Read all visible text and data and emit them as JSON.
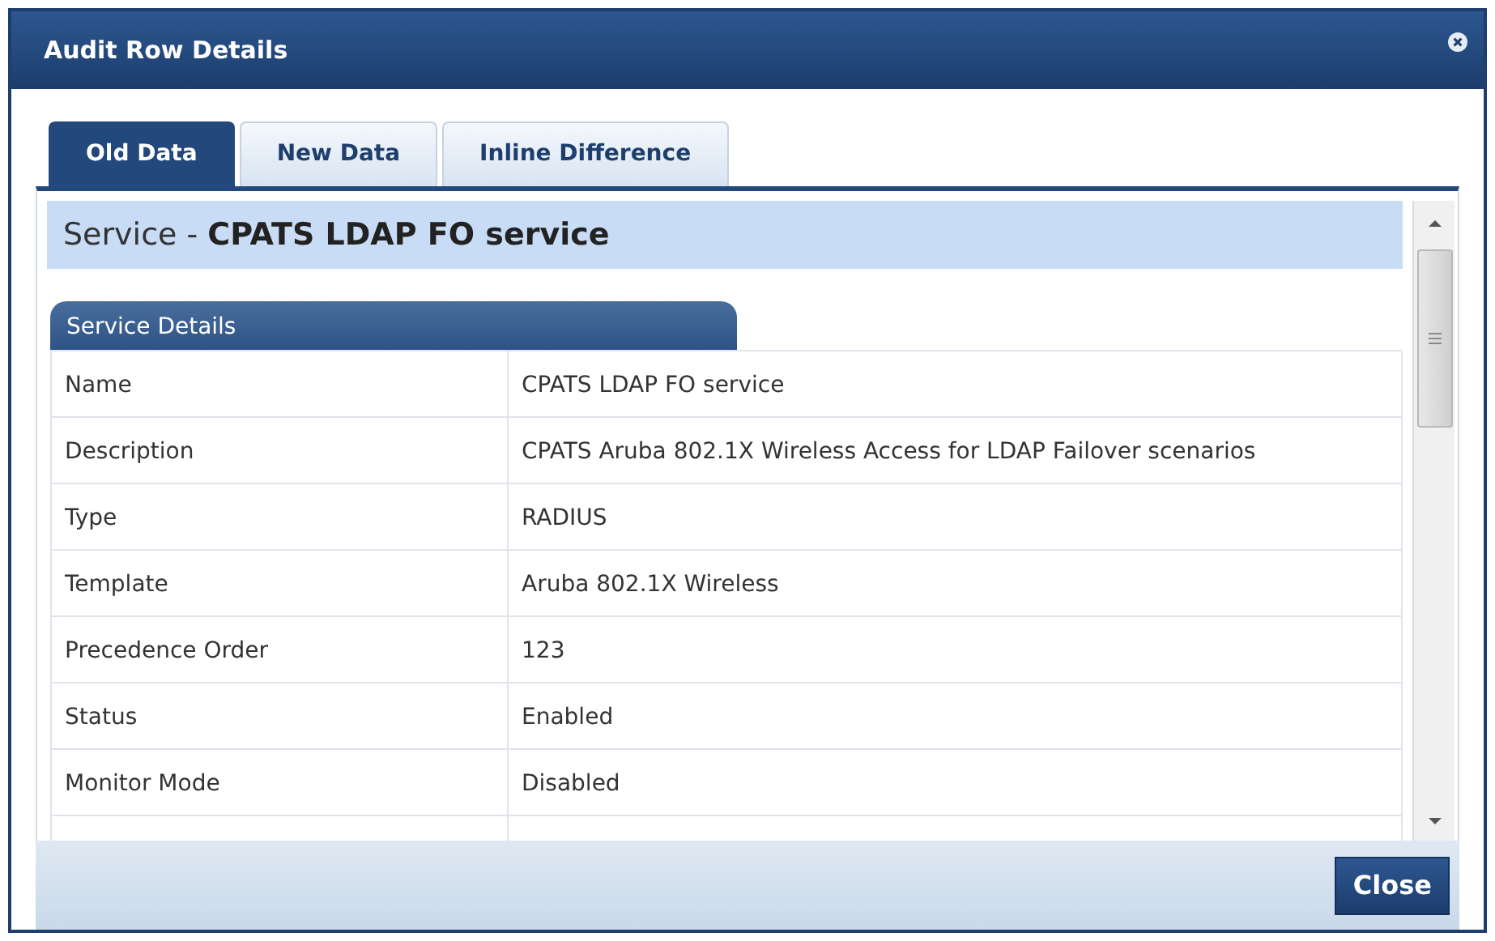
{
  "window": {
    "title": "Audit Row Details"
  },
  "tabs": [
    {
      "label": "Old Data",
      "selected": true
    },
    {
      "label": "New Data",
      "selected": false
    },
    {
      "label": "Inline Difference",
      "selected": false
    }
  ],
  "header": {
    "prefix": "Service - ",
    "name": "CPATS LDAP FO service"
  },
  "section": {
    "title": "Service Details",
    "rows": [
      {
        "label": "Name",
        "value": "CPATS LDAP FO service"
      },
      {
        "label": "Description",
        "value": "CPATS Aruba 802.1X Wireless Access for LDAP Failover scenarios"
      },
      {
        "label": "Type",
        "value": "RADIUS"
      },
      {
        "label": "Template",
        "value": "Aruba 802.1X Wireless"
      },
      {
        "label": "Precedence Order",
        "value": "123"
      },
      {
        "label": "Status",
        "value": "Enabled"
      },
      {
        "label": "Monitor Mode",
        "value": "Disabled"
      }
    ]
  },
  "buttons": [
    "Close"
  ]
}
